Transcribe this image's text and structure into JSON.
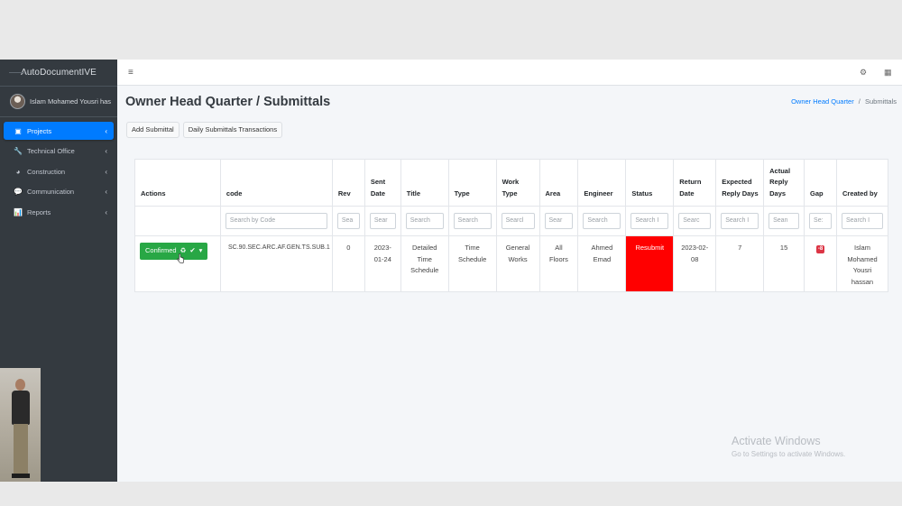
{
  "sidebar": {
    "brand": "AutoDocumentIVE",
    "user_name": "Islam Mohamed Yousri has",
    "items": [
      {
        "label": "Projects",
        "icon": "building-icon",
        "glyph": "▣",
        "active": true
      },
      {
        "label": "Technical Office",
        "icon": "wrench-icon",
        "glyph": "🔧",
        "active": false
      },
      {
        "label": "Construction",
        "icon": "pie-chart-icon",
        "glyph": "◕",
        "active": false
      },
      {
        "label": "Communication",
        "icon": "comments-icon",
        "glyph": "💬",
        "active": false
      },
      {
        "label": "Reports",
        "icon": "chart-icon",
        "glyph": "📊",
        "active": false
      }
    ],
    "caret": "‹"
  },
  "topbar": {
    "menu_glyph": "≡",
    "settings_glyph": "⚙",
    "grid_glyph": "▦"
  },
  "page": {
    "title": "Owner Head Quarter / Submittals",
    "breadcrumb_link": "Owner Head Quarter",
    "breadcrumb_sep": "/",
    "breadcrumb_current": "Submittals"
  },
  "buttons": {
    "add": "Add Submittal",
    "daily": "Daily Submittals Transactions"
  },
  "table": {
    "columns": [
      {
        "key": "actions",
        "lines": [
          "Actions"
        ],
        "search": ""
      },
      {
        "key": "code",
        "lines": [
          "code"
        ],
        "search": "Search by Code"
      },
      {
        "key": "rev",
        "lines": [
          "Rev"
        ],
        "search": "Sea"
      },
      {
        "key": "sent_date",
        "lines": [
          "Sent",
          "Date"
        ],
        "search": "Sear"
      },
      {
        "key": "title",
        "lines": [
          "Title"
        ],
        "search": "Search"
      },
      {
        "key": "type",
        "lines": [
          "Type"
        ],
        "search": "Search"
      },
      {
        "key": "work_type",
        "lines": [
          "Work",
          "Type"
        ],
        "search": "Searcl"
      },
      {
        "key": "area",
        "lines": [
          "Area"
        ],
        "search": "Sear"
      },
      {
        "key": "engineer",
        "lines": [
          "Engineer"
        ],
        "search": "Search"
      },
      {
        "key": "status",
        "lines": [
          "Status"
        ],
        "search": "Search I"
      },
      {
        "key": "return_date",
        "lines": [
          "Return",
          "Date"
        ],
        "search": "Searc"
      },
      {
        "key": "expected_reply_days",
        "lines": [
          "Expected",
          "Reply Days"
        ],
        "search": "Search I"
      },
      {
        "key": "actual_reply_days",
        "lines": [
          "Actual",
          "Reply",
          "Days"
        ],
        "search": "Sean"
      },
      {
        "key": "gap",
        "lines": [
          "Gap"
        ],
        "search": "Se:"
      },
      {
        "key": "created_by",
        "lines": [
          "Created by"
        ],
        "search": "Search I"
      }
    ],
    "row": {
      "action_label": "Confirmed",
      "code": "SC.90.SEC.ARC.AF.GEN.TS.SUB.1",
      "rev": "0",
      "sent_date": [
        "2023-",
        "01-24"
      ],
      "title": [
        "Detailed",
        "Time",
        "Schedule"
      ],
      "type": [
        "Time",
        "Schedule"
      ],
      "work_type": [
        "General",
        "Works"
      ],
      "area": [
        "All",
        "Floors"
      ],
      "engineer": [
        "Ahmed",
        "Emad"
      ],
      "status": "Resubmit",
      "return_date": [
        "2023-02-",
        "08"
      ],
      "expected_reply_days": "7",
      "actual_reply_days": "15",
      "gap": "-8",
      "created_by": [
        "Islam",
        "Mohamed",
        "Yousri",
        "hassan"
      ]
    }
  },
  "watermark": {
    "title": "Activate Windows",
    "subtitle": "Go to Settings to activate Windows."
  },
  "colors": {
    "sidebar_bg": "#343a40",
    "active_nav": "#007bff",
    "confirm_btn": "#28a745",
    "status_red": "#ff0000",
    "gap_badge": "#dc3545"
  }
}
